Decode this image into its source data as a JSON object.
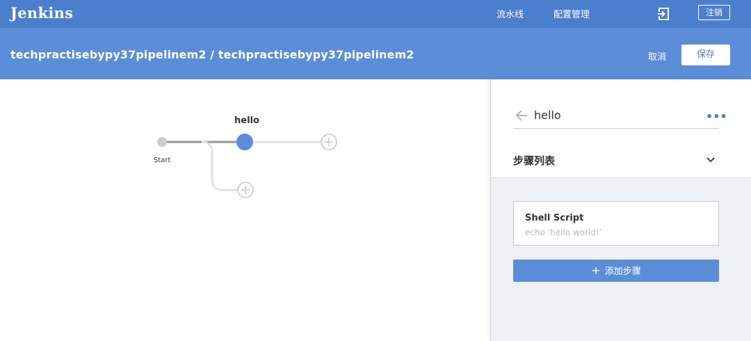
{
  "app": {
    "logo": "Jenkins"
  },
  "nav": {
    "pipelines": "流水线",
    "admin": "配置管理",
    "exit_icon": "exit-icon",
    "logout": "注销"
  },
  "header": {
    "breadcrumb": "techpractisebypy37pipelinem2 / techpractisebypy37pipelinem2",
    "cancel": "取消",
    "save": "保存"
  },
  "graph": {
    "start_label": "Start",
    "stage_label": "hello"
  },
  "panel": {
    "stage_name": "hello",
    "more": "•••",
    "steps_title": "步骤列表",
    "steps": [
      {
        "name": "Shell Script",
        "description": "echo 'hello world!'"
      }
    ],
    "add_step": "添加步骤"
  },
  "colors": {
    "nav_bg": "#4a7fce",
    "header_bg": "#5b8dd9",
    "stage_node": "#5b8dd9",
    "panel_bg": "#eef1f4"
  }
}
